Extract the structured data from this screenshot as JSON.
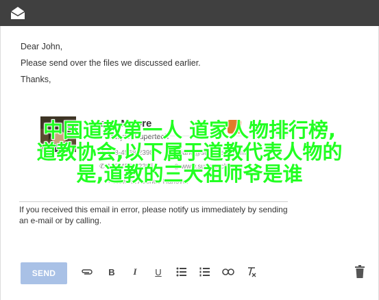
{
  "header": {
    "logo_icon": "mail-envelope-icon",
    "bg": "#404040"
  },
  "message": {
    "greeting": "Dear John,",
    "body": "Please send over the files we discussed earlier.",
    "closing": "Thanks,"
  },
  "signature": {
    "name": "Jane Moore",
    "title": "Lawyer, Supertech",
    "phone": "178-4568-2398",
    "email": "jane@supertech.com",
    "mobile": "178-4568-2395",
    "website": "www.supertech.com",
    "address": "Newest Avenue Hanover"
  },
  "overlay": {
    "line1": "中国道教第一人  道家人物排行榜,",
    "line2": "道教协会,以下属于道教代表人物的",
    "line3": "是,道教的三大祖师爷是谁",
    "color": "#22ff22"
  },
  "disclaimer": "If you received this email in error, please notify us immediately by sending an e-mail or by calling.",
  "toolbar": {
    "send_label": "SEND",
    "send_color": "#a9c1e6",
    "icons": [
      "attach-icon",
      "bold-icon",
      "italic-icon",
      "underline-icon",
      "bulleted-list-icon",
      "numbered-list-icon",
      "link-icon",
      "clear-formatting-icon",
      "trash-icon"
    ],
    "bold_glyph": "B",
    "italic_glyph": "I",
    "underline_glyph": "U"
  }
}
